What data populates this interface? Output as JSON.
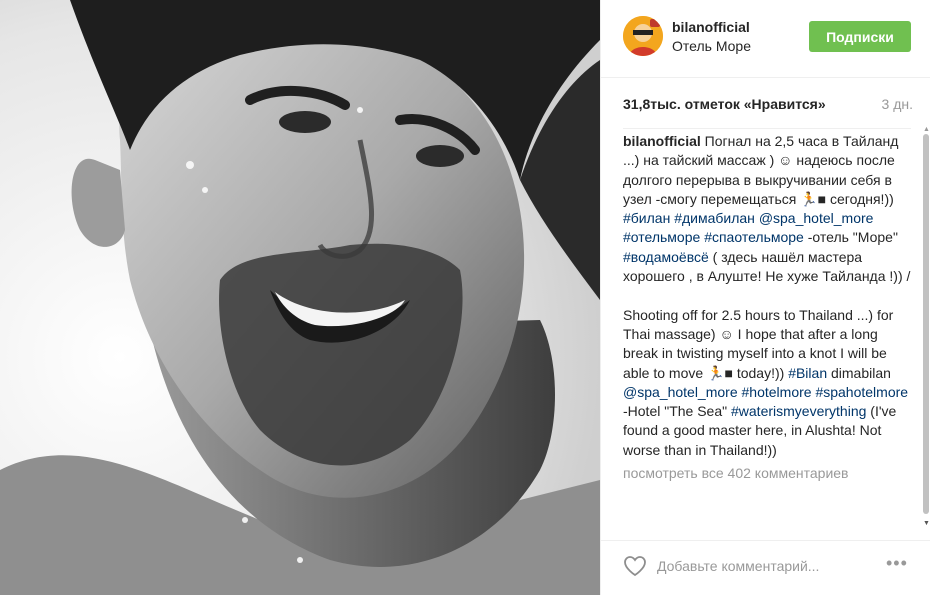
{
  "post": {
    "username": "bilanofficial",
    "location": "Отель Море",
    "follow_label": "Подписки",
    "likes": "31,8тыс. отметок «Нравится»",
    "time_ago": "3 дн."
  },
  "caption": {
    "author": "bilanofficial",
    "segments": [
      {
        "text": " Погнал на 2,5 часа в Тайланд ...) на тайский массаж ) ☺ надеюсь после долгого перерыва в выкручивании себя в узел -смогу перемещаться 🏃■ сегодня!)) ",
        "tag": false
      },
      {
        "text": "#билан",
        "tag": true
      },
      {
        "text": " ",
        "tag": false
      },
      {
        "text": "#димабилан",
        "tag": true
      },
      {
        "text": " ",
        "tag": false
      },
      {
        "text": "@spa_hotel_more",
        "tag": true
      },
      {
        "text": " ",
        "tag": false
      },
      {
        "text": "#отельморе",
        "tag": true
      },
      {
        "text": " ",
        "tag": false
      },
      {
        "text": "#спаотельморе",
        "tag": true
      },
      {
        "text": " -отель \"Море\" ",
        "tag": false
      },
      {
        "text": "#водамоёвсё",
        "tag": true
      },
      {
        "text": " ( здесь нашёл мастера хорошего , в Алуште! Не хуже Тайланда !)) /\n\nShooting off for 2.5 hours to Thailand ...) for Thai massage) ☺ I hope that after a long break in twisting myself into a knot I will be able to move 🏃■ today!)) ",
        "tag": false
      },
      {
        "text": "#Bilan",
        "tag": true
      },
      {
        "text": " dimabilan ",
        "tag": false
      },
      {
        "text": "@spa_hotel_more",
        "tag": true
      },
      {
        "text": " ",
        "tag": false
      },
      {
        "text": "#hotelmore",
        "tag": true
      },
      {
        "text": " ",
        "tag": false
      },
      {
        "text": "#spahotelmore",
        "tag": true
      },
      {
        "text": " -Hotel \"The Sea\" ",
        "tag": false
      },
      {
        "text": "#waterismyeverything",
        "tag": true
      },
      {
        "text": " (I've found a good master here, in Alushta! Not worse than in Thailand!))",
        "tag": false
      }
    ]
  },
  "comments": {
    "view_all": "посмотреть все 402 комментариев"
  },
  "footer": {
    "comment_placeholder": "Добавьте комментарий...",
    "more_label": "•••"
  },
  "colors": {
    "follow_button": "#70c050",
    "hashtag": "#003569",
    "muted": "#999999"
  },
  "icons": [
    "heart-icon",
    "more-options-icon",
    "avatar-image",
    "scroll-up-arrow-icon",
    "scroll-down-arrow-icon"
  ]
}
